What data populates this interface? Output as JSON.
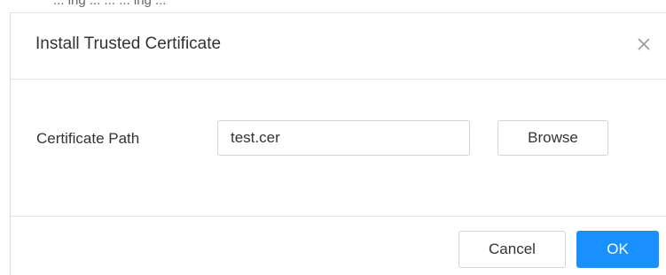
{
  "background_fragment": "... ing ... ... ... ing ...",
  "dialog": {
    "title": "Install Trusted Certificate",
    "close_icon": "close-icon"
  },
  "form": {
    "certificate_path_label": "Certificate Path",
    "certificate_path_value": "test.cer",
    "browse_label": "Browse"
  },
  "footer": {
    "cancel_label": "Cancel",
    "ok_label": "OK"
  },
  "colors": {
    "primary": "#1890ff",
    "border": "#d4d4d4",
    "text": "#333333",
    "divider": "#e5e5e5"
  }
}
